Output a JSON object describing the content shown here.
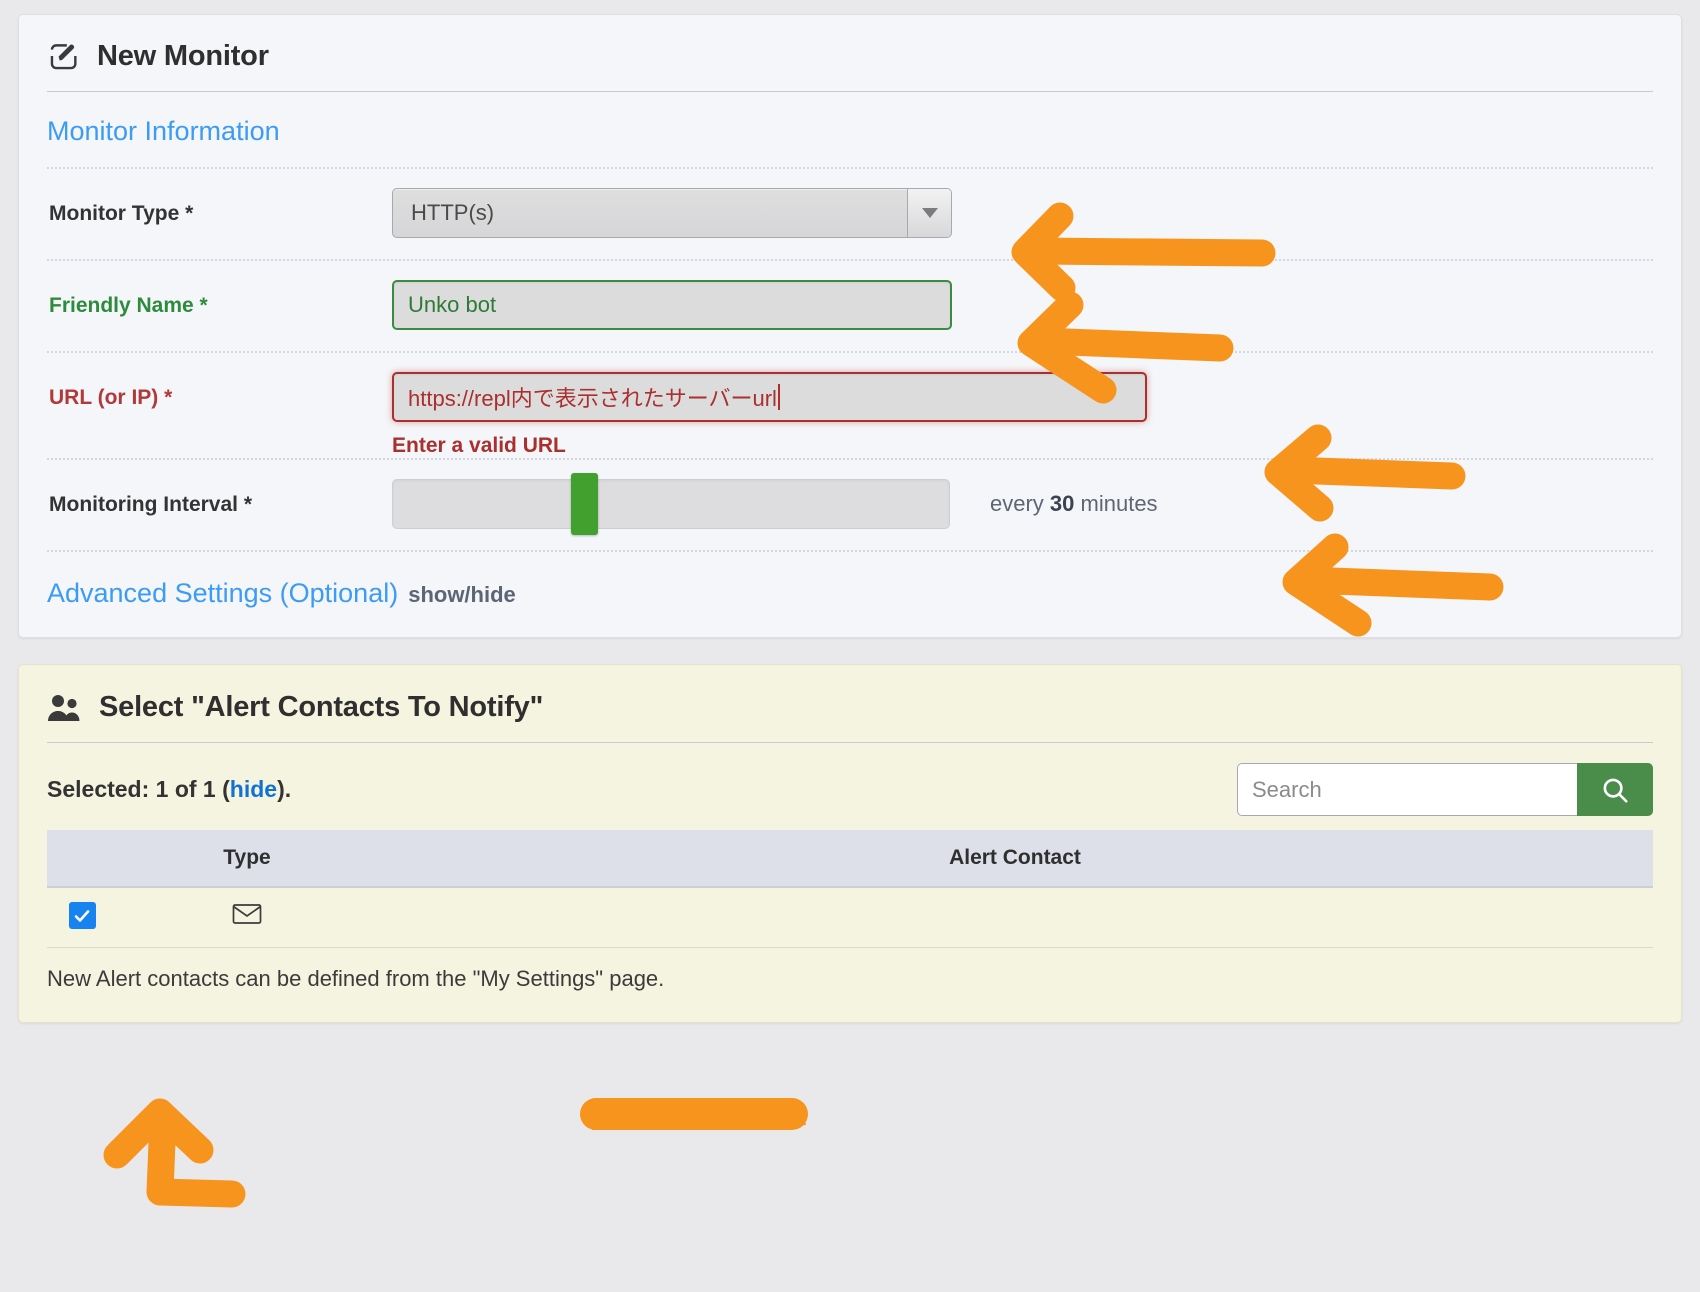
{
  "monitor_panel": {
    "header": {
      "icon": "pencil-square-icon",
      "title": "New Monitor"
    },
    "section_title": "Monitor Information",
    "fields": {
      "monitor_type": {
        "label": "Monitor Type *",
        "value": "HTTP(s)",
        "dropdown_icon": "caret-down-icon"
      },
      "friendly_name": {
        "label": "Friendly Name *",
        "value": "Unko bot",
        "state_color": "#2e8b3d"
      },
      "url": {
        "label": "URL (or IP) *",
        "value": "https://repl内で表示されたサーバーurl",
        "error": "Enter a valid URL",
        "state_color": "#a9302f"
      },
      "interval": {
        "label": "Monitoring Interval *",
        "prefix": "every ",
        "amount": "30",
        "suffix": " minutes",
        "handle_color": "#41a02e"
      }
    },
    "advanced": {
      "title": "Advanced Settings (Optional)",
      "toggle": "show/hide"
    }
  },
  "alerts_panel": {
    "header": {
      "icon": "users-icon",
      "title": "Select \"Alert Contacts To Notify\""
    },
    "selected_prefix": "Selected: 1 of 1 (",
    "selected_link": "hide",
    "selected_suffix": ").",
    "search": {
      "placeholder": "Search",
      "button_icon": "search-icon",
      "button_color": "#4a8c4a"
    },
    "table": {
      "columns": [
        "",
        "Type",
        "Alert Contact"
      ],
      "rows": [
        {
          "checked": true,
          "type_icon": "envelope-icon",
          "contact": ""
        }
      ]
    },
    "footer_note": "New Alert contacts can be defined from the \"My Settings\" page."
  },
  "annotations": {
    "color": "#f7941e",
    "arrows": [
      "arrow-to-monitor-type",
      "arrow-to-friendly-name",
      "arrow-to-url",
      "arrow-to-interval",
      "arrow-to-checkbox"
    ],
    "redactions": [
      "redaction-over-alert-contact"
    ]
  }
}
